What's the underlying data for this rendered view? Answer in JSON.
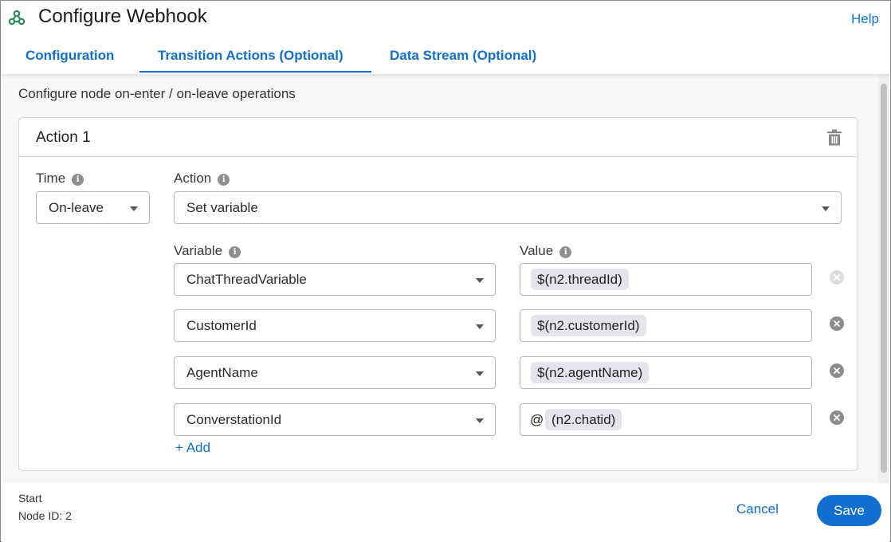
{
  "header": {
    "title": "Configure Webhook",
    "help_label": "Help",
    "logo_icon": "webhook-icon",
    "accent_color": "#1170cf"
  },
  "tabs": [
    {
      "label": "Configuration",
      "active": false
    },
    {
      "label": "Transition Actions (Optional)",
      "active": true
    },
    {
      "label": "Data Stream (Optional)",
      "active": false
    }
  ],
  "main": {
    "subtitle": "Configure node on-enter / on-leave operations",
    "action_card": {
      "title": "Action 1",
      "delete_icon": "trash-icon",
      "time_label": "Time",
      "time_value": "On-leave",
      "action_label": "Action",
      "action_value": "Set variable",
      "variable_label": "Variable",
      "value_label": "Value",
      "rows": [
        {
          "variable": "ChatThreadVariable",
          "value": "$(n2.threadId)",
          "prefix": "",
          "remove_enabled": false
        },
        {
          "variable": "CustomerId",
          "value": "$(n2.customerId)",
          "prefix": "",
          "remove_enabled": true
        },
        {
          "variable": "AgentName",
          "value": "$(n2.agentName)",
          "prefix": "",
          "remove_enabled": true
        },
        {
          "variable": "ConverstationId",
          "value": "(n2.chatid)",
          "prefix": "@",
          "remove_enabled": true
        }
      ],
      "add_label": "+ Add"
    }
  },
  "footer": {
    "node_name": "Start",
    "node_id": "Node ID: 2",
    "cancel_label": "Cancel",
    "save_label": "Save"
  }
}
